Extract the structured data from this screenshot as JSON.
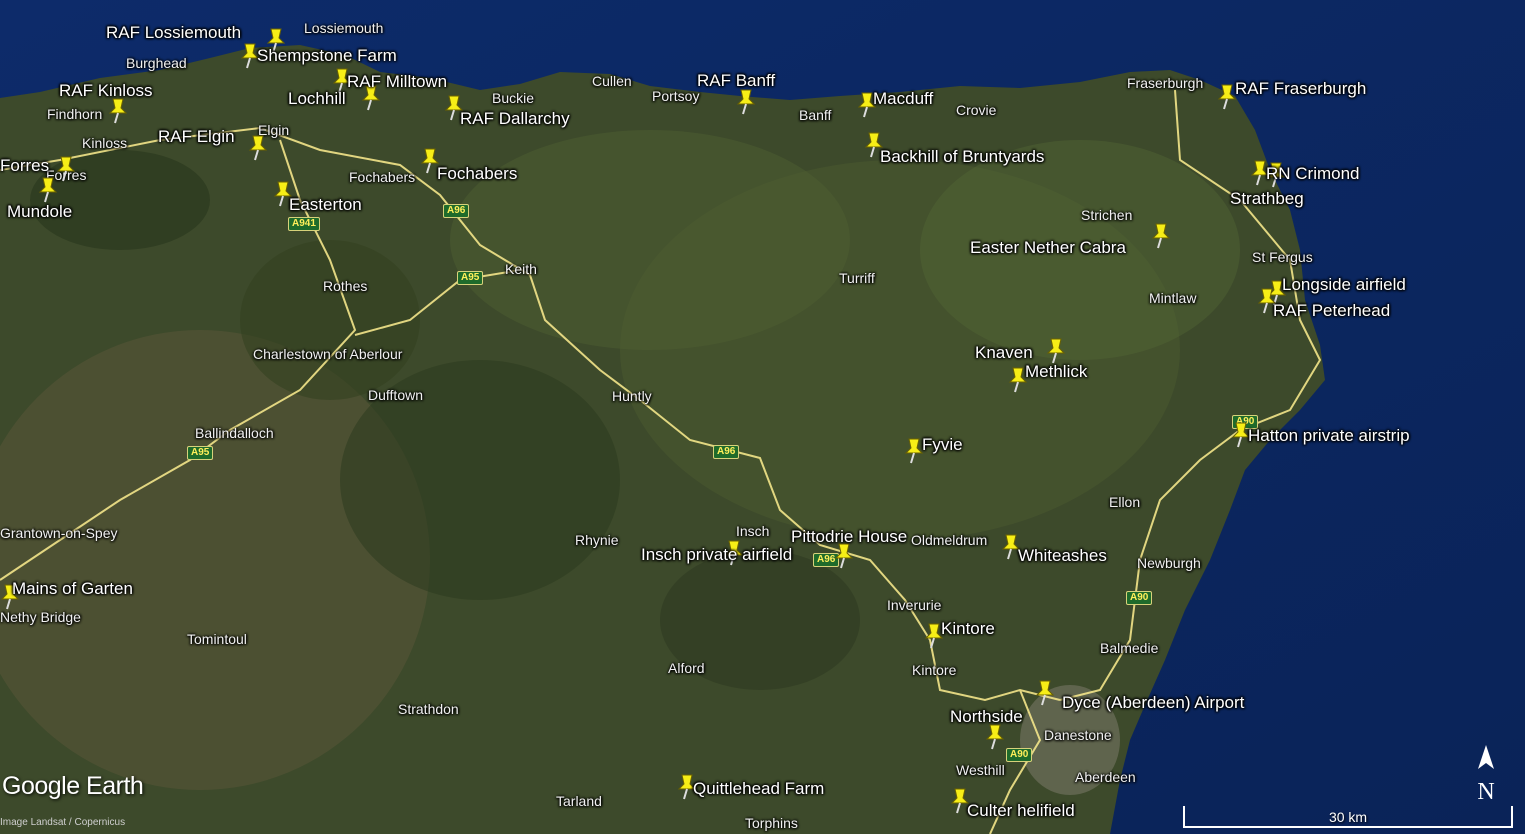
{
  "branding": {
    "logo": "Google Earth",
    "imagery_credit": "Image Landsat / Copernicus"
  },
  "compass": {
    "north_label": "N"
  },
  "scale": {
    "label": "30 km"
  },
  "colors": {
    "sea": "#0c2a66",
    "land": "#3c4a2a",
    "road": "#f3e58a",
    "pin": "#f7ee16"
  },
  "pins": [
    {
      "name": "RAF Lossiemouth"
    },
    {
      "name": "Shempstone Farm"
    },
    {
      "name": "RAF Kinloss"
    },
    {
      "name": "RAF Milltown"
    },
    {
      "name": "Lochhill"
    },
    {
      "name": "RAF Dallarchy"
    },
    {
      "name": "RAF Elgin"
    },
    {
      "name": "Forres"
    },
    {
      "name": "Mundole"
    },
    {
      "name": "Fochabers"
    },
    {
      "name": "Easterton"
    },
    {
      "name": "RAF Banff"
    },
    {
      "name": "Macduff"
    },
    {
      "name": "Backhill of Bruntyards"
    },
    {
      "name": "RAF Fraserburgh"
    },
    {
      "name": "RN Crimond"
    },
    {
      "name": "Strathbeg"
    },
    {
      "name": "Easter Nether Cabra"
    },
    {
      "name": "Longside airfield"
    },
    {
      "name": "RAF Peterhead"
    },
    {
      "name": "Knaven"
    },
    {
      "name": "Methlick"
    },
    {
      "name": "Fyvie"
    },
    {
      "name": "Hatton private airstrip"
    },
    {
      "name": "Pittodrie House"
    },
    {
      "name": "Insch private airfield"
    },
    {
      "name": "Whiteashes"
    },
    {
      "name": "Kintore"
    },
    {
      "name": "Dyce (Aberdeen) Airport"
    },
    {
      "name": "Northside"
    },
    {
      "name": "Quittlehead Farm"
    },
    {
      "name": "Culter helifield"
    },
    {
      "name": "Mains of Garten"
    }
  ],
  "towns": [
    "Lossiemouth",
    "Burghead",
    "Findhorn",
    "Kinloss",
    "Elgin",
    "Forres",
    "Buckie",
    "Cullen",
    "Portsoy",
    "Banff",
    "Crovie",
    "Fraserburgh",
    "Fochabers",
    "Strichen",
    "St Fergus",
    "Mintlaw",
    "Keith",
    "Rothes",
    "Turriff",
    "Charlestown of Aberlour",
    "Dufftown",
    "Huntly",
    "Ballindalloch",
    "Grantown-on-Spey",
    "Ellon",
    "Insch",
    "Rhynie",
    "Oldmeldrum",
    "Newburgh",
    "Nethy Bridge",
    "Tomintoul",
    "Inverurie",
    "Balmedie",
    "Alford",
    "Kintore",
    "Strathdon",
    "Danestone",
    "Westhill",
    "Aberdeen",
    "Tarland",
    "Torphins"
  ],
  "roads": [
    "A941",
    "A96",
    "A95",
    "A96",
    "A95",
    "A96",
    "A96",
    "A90",
    "A90",
    "A90"
  ]
}
